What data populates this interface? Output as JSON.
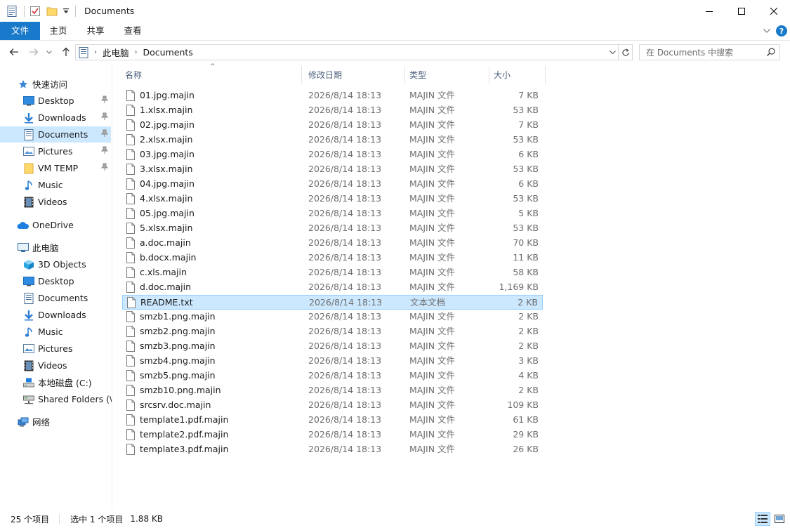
{
  "window": {
    "title": "Documents"
  },
  "ribbon": {
    "tabs": [
      "文件",
      "主页",
      "共享",
      "查看"
    ]
  },
  "address": {
    "crumbs": [
      "此电脑",
      "Documents"
    ],
    "search_placeholder": "在 Documents 中搜索"
  },
  "sidebar": {
    "quick_access": "快速访问",
    "quick_items": [
      "Desktop",
      "Downloads",
      "Documents",
      "Pictures",
      "VM TEMP",
      "Music",
      "Videos"
    ],
    "onedrive": "OneDrive",
    "this_pc": "此电脑",
    "pc_items": [
      "3D Objects",
      "Desktop",
      "Documents",
      "Downloads",
      "Music",
      "Pictures",
      "Videos",
      "本地磁盘 (C:)",
      "Shared Folders (\\\\"
    ],
    "network": "网络"
  },
  "columns": {
    "name": "名称",
    "date": "修改日期",
    "type": "类型",
    "size": "大小"
  },
  "files": [
    {
      "name": "01.jpg.majin",
      "date": "2026/8/14 18:13",
      "type": "MAJIN 文件",
      "size": "7 KB"
    },
    {
      "name": "1.xlsx.majin",
      "date": "2026/8/14 18:13",
      "type": "MAJIN 文件",
      "size": "53 KB"
    },
    {
      "name": "02.jpg.majin",
      "date": "2026/8/14 18:13",
      "type": "MAJIN 文件",
      "size": "7 KB"
    },
    {
      "name": "2.xlsx.majin",
      "date": "2026/8/14 18:13",
      "type": "MAJIN 文件",
      "size": "53 KB"
    },
    {
      "name": "03.jpg.majin",
      "date": "2026/8/14 18:13",
      "type": "MAJIN 文件",
      "size": "6 KB"
    },
    {
      "name": "3.xlsx.majin",
      "date": "2026/8/14 18:13",
      "type": "MAJIN 文件",
      "size": "53 KB"
    },
    {
      "name": "04.jpg.majin",
      "date": "2026/8/14 18:13",
      "type": "MAJIN 文件",
      "size": "6 KB"
    },
    {
      "name": "4.xlsx.majin",
      "date": "2026/8/14 18:13",
      "type": "MAJIN 文件",
      "size": "53 KB"
    },
    {
      "name": "05.jpg.majin",
      "date": "2026/8/14 18:13",
      "type": "MAJIN 文件",
      "size": "5 KB"
    },
    {
      "name": "5.xlsx.majin",
      "date": "2026/8/14 18:13",
      "type": "MAJIN 文件",
      "size": "53 KB"
    },
    {
      "name": "a.doc.majin",
      "date": "2026/8/14 18:13",
      "type": "MAJIN 文件",
      "size": "70 KB"
    },
    {
      "name": "b.docx.majin",
      "date": "2026/8/14 18:13",
      "type": "MAJIN 文件",
      "size": "11 KB"
    },
    {
      "name": "c.xls.majin",
      "date": "2026/8/14 18:13",
      "type": "MAJIN 文件",
      "size": "58 KB"
    },
    {
      "name": "d.doc.majin",
      "date": "2026/8/14 18:13",
      "type": "MAJIN 文件",
      "size": "1,169 KB"
    },
    {
      "name": "README.txt",
      "date": "2026/8/14 18:13",
      "type": "文本文档",
      "size": "2 KB",
      "selected": true
    },
    {
      "name": "smzb1.png.majin",
      "date": "2026/8/14 18:13",
      "type": "MAJIN 文件",
      "size": "2 KB"
    },
    {
      "name": "smzb2.png.majin",
      "date": "2026/8/14 18:13",
      "type": "MAJIN 文件",
      "size": "2 KB"
    },
    {
      "name": "smzb3.png.majin",
      "date": "2026/8/14 18:13",
      "type": "MAJIN 文件",
      "size": "2 KB"
    },
    {
      "name": "smzb4.png.majin",
      "date": "2026/8/14 18:13",
      "type": "MAJIN 文件",
      "size": "3 KB"
    },
    {
      "name": "smzb5.png.majin",
      "date": "2026/8/14 18:13",
      "type": "MAJIN 文件",
      "size": "4 KB"
    },
    {
      "name": "smzb10.png.majin",
      "date": "2026/8/14 18:13",
      "type": "MAJIN 文件",
      "size": "2 KB"
    },
    {
      "name": "srcsrv.doc.majin",
      "date": "2026/8/14 18:13",
      "type": "MAJIN 文件",
      "size": "109 KB"
    },
    {
      "name": "template1.pdf.majin",
      "date": "2026/8/14 18:13",
      "type": "MAJIN 文件",
      "size": "61 KB"
    },
    {
      "name": "template2.pdf.majin",
      "date": "2026/8/14 18:13",
      "type": "MAJIN 文件",
      "size": "29 KB"
    },
    {
      "name": "template3.pdf.majin",
      "date": "2026/8/14 18:13",
      "type": "MAJIN 文件",
      "size": "26 KB"
    }
  ],
  "status": {
    "count": "25 个项目",
    "selected": "选中 1 个项目",
    "selected_size": "1.88 KB"
  },
  "colors": {
    "accent": "#1979ca",
    "selection": "#cce8ff",
    "selection_border": "#99d1ff",
    "header_text": "#4c607a"
  }
}
